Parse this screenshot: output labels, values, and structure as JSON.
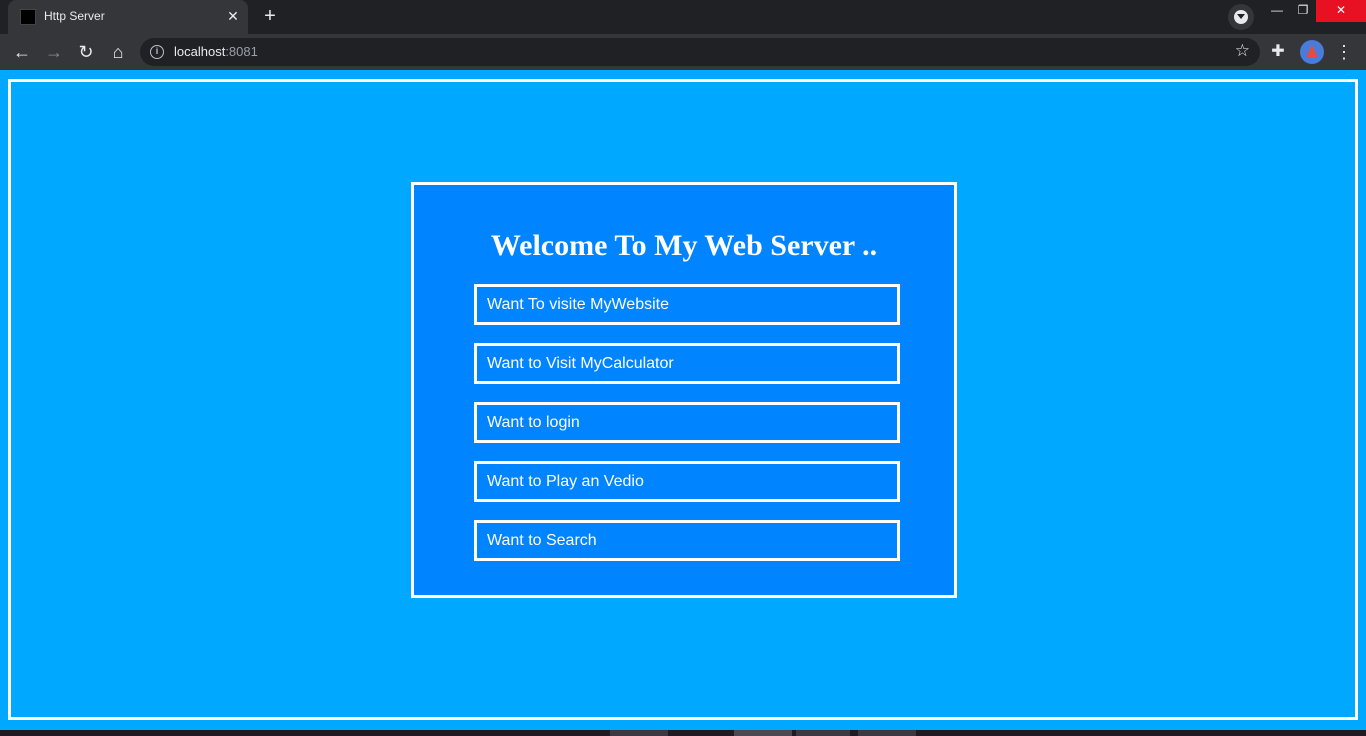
{
  "browser": {
    "tab_title": "Http Server",
    "tab_close_glyph": "✕",
    "new_tab_glyph": "+",
    "window_min_glyph": "—",
    "window_max_glyph": "❐",
    "window_close_glyph": "✕",
    "back_glyph": "←",
    "forward_glyph": "→",
    "reload_glyph": "↻",
    "home_glyph": "⌂",
    "info_glyph": "i",
    "url_host": "localhost",
    "url_port": ":8081",
    "star_glyph": "☆",
    "extensions_glyph": "✚",
    "menu_glyph": "⋮"
  },
  "page": {
    "heading": "Welcome To My Web Server ..",
    "links": [
      {
        "label": "Want To visite MyWebsite"
      },
      {
        "label": "Want to Visit MyCalculator"
      },
      {
        "label": "Want to login"
      },
      {
        "label": "Want to Play an Vedio"
      },
      {
        "label": "Want to Search"
      }
    ]
  },
  "colors": {
    "page_background": "#00a8ff",
    "card_background": "#0184ff",
    "border": "#ffffff",
    "text": "#ffffff",
    "browser_frame": "#35363a",
    "close_button": "#e81123"
  }
}
